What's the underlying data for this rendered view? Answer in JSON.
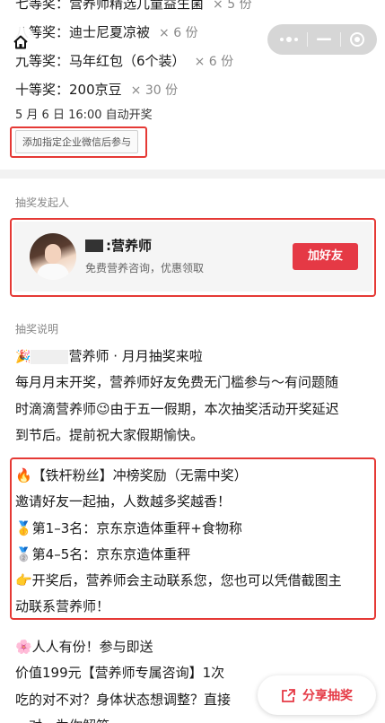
{
  "prizes": [
    {
      "rank": "七等奖：",
      "name": "营养师精选儿童益生菌",
      "qty": "× 5 份"
    },
    {
      "rank": "八等奖：",
      "name": "迪士尼夏凉被",
      "qty": "× 6 份"
    },
    {
      "rank": "九等奖：",
      "name": "马年红包（6个装）",
      "qty": "× 6 份"
    },
    {
      "rank": "十等奖：",
      "name": "200京豆",
      "qty": "× 30 份"
    }
  ],
  "draw_time": "5 月 6 日 16:00 自动开奖",
  "condition_tag": "添加指定企业微信后参与",
  "host": {
    "section_title": "抽奖发起人",
    "name": ":营养师",
    "desc": "免费营养咨询，优惠领取",
    "add_button": "加好友"
  },
  "explain": {
    "section_title": "抽奖说明",
    "para1": {
      "emoji": "🎉",
      "title": "营养师 · 月月抽奖来啦",
      "lines": [
        "每月月末开奖，营养师好友免费无门槛参与～有问题随",
        "时滴滴营养师😉由于五一假期，本次抽奖活动开奖延迟",
        "到节后。提前祝大家假期愉快。"
      ]
    },
    "para2": {
      "lines": [
        "🔥【铁杆粉丝】冲榜奖励（无需中奖）",
        "邀请好友一起抽，人数越多奖越香！",
        "🥇第1–3名：京东京造体重秤+食物称",
        "🥈第4–5名：京东京造体重秤",
        "👉开奖后，营养师会主动联系您，您也可以凭借截图主",
        "动联系营养师！"
      ]
    },
    "para3": {
      "lines": [
        "🌸人人有份！参与即送",
        "价值199元【营养师专属咨询】1次",
        "吃的对不对？身体状态想调整？直接",
        "一对一为你解答。"
      ]
    }
  },
  "share_button": "分享抽奖",
  "icons": {
    "home": "home-icon",
    "more": "more-dots-icon",
    "minimize": "minimize-icon",
    "close": "close-target-icon",
    "share": "share-icon"
  },
  "colors": {
    "accent": "#e53945",
    "highlight_outline": "#e53935"
  }
}
